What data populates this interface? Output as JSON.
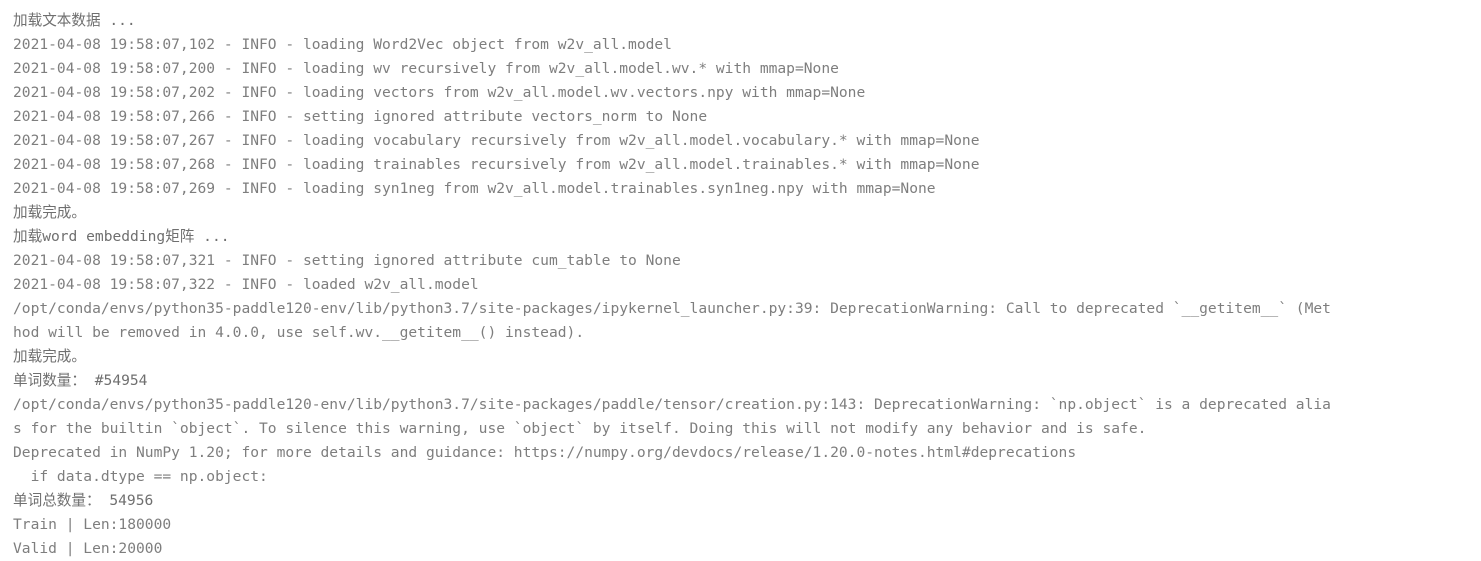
{
  "window": {
    "background_color": "#ffffff",
    "text_color": "#7e7e7e"
  },
  "output": {
    "stream_name": "stdout",
    "line_count": 20,
    "lines": [
      {
        "text": "加载文本数据 ...",
        "kind": "cjk"
      },
      {
        "text": "2021-04-08 19:58:07,102 - INFO - loading Word2Vec object from w2v_all.model",
        "kind": "log"
      },
      {
        "text": "2021-04-08 19:58:07,200 - INFO - loading wv recursively from w2v_all.model.wv.* with mmap=None",
        "kind": "log"
      },
      {
        "text": "2021-04-08 19:58:07,202 - INFO - loading vectors from w2v_all.model.wv.vectors.npy with mmap=None",
        "kind": "log"
      },
      {
        "text": "2021-04-08 19:58:07,266 - INFO - setting ignored attribute vectors_norm to None",
        "kind": "log"
      },
      {
        "text": "2021-04-08 19:58:07,267 - INFO - loading vocabulary recursively from w2v_all.model.vocabulary.* with mmap=None",
        "kind": "log"
      },
      {
        "text": "2021-04-08 19:58:07,268 - INFO - loading trainables recursively from w2v_all.model.trainables.* with mmap=None",
        "kind": "log"
      },
      {
        "text": "2021-04-08 19:58:07,269 - INFO - loading syn1neg from w2v_all.model.trainables.syn1neg.npy with mmap=None",
        "kind": "log"
      },
      {
        "text": "加载完成。",
        "kind": "cjk"
      },
      {
        "text": "加载word embedding矩阵 ...",
        "kind": "cjk"
      },
      {
        "text": "2021-04-08 19:58:07,321 - INFO - setting ignored attribute cum_table to None",
        "kind": "log"
      },
      {
        "text": "2021-04-08 19:58:07,322 - INFO - loaded w2v_all.model",
        "kind": "log"
      },
      {
        "text": "/opt/conda/envs/python35-paddle120-env/lib/python3.7/site-packages/ipykernel_launcher.py:39: DeprecationWarning: Call to deprecated `__getitem__` (Met",
        "kind": "log"
      },
      {
        "text": "hod will be removed in 4.0.0, use self.wv.__getitem__() instead).",
        "kind": "log"
      },
      {
        "text": "加载完成。",
        "kind": "cjk"
      },
      {
        "text": "单词数量： #54954",
        "kind": "cjk"
      },
      {
        "text": "/opt/conda/envs/python35-paddle120-env/lib/python3.7/site-packages/paddle/tensor/creation.py:143: DeprecationWarning: `np.object` is a deprecated alia",
        "kind": "log"
      },
      {
        "text": "s for the builtin `object`. To silence this warning, use `object` by itself. Doing this will not modify any behavior and is safe.",
        "kind": "log"
      },
      {
        "text": "Deprecated in NumPy 1.20; for more details and guidance: https://numpy.org/devdocs/release/1.20.0-notes.html#deprecations",
        "kind": "log"
      },
      {
        "text": "  if data.dtype == np.object:",
        "kind": "log"
      },
      {
        "text": "单词总数量： 54956",
        "kind": "cjk"
      },
      {
        "text": "Train | Len:180000",
        "kind": "log"
      },
      {
        "text": "Valid | Len:20000",
        "kind": "log"
      }
    ]
  }
}
